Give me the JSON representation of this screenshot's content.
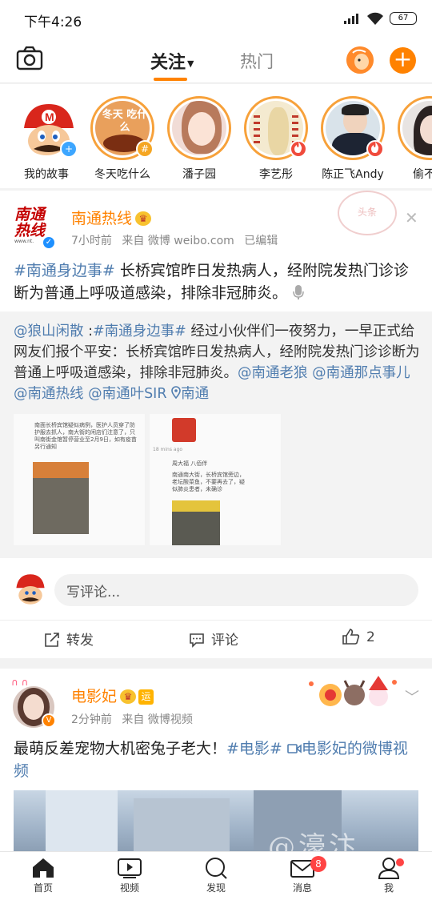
{
  "status_bar": {
    "time": "下午4:26",
    "battery": "67"
  },
  "top_nav": {
    "follow_tab": "关注",
    "hot_tab": "热门"
  },
  "stories": [
    {
      "name": "我的故事",
      "badge": "+"
    },
    {
      "name": "冬天吃什么",
      "cover_text": "冬天 吃什么",
      "badge": "#"
    },
    {
      "name": "潘子园"
    },
    {
      "name": "李艺彤",
      "badge": "fire"
    },
    {
      "name": "陈正飞Andy",
      "badge": "fire"
    },
    {
      "name": "偷不走"
    }
  ],
  "post1": {
    "logo_text": "南通热线",
    "logo_url": "www.nt.",
    "author": "南通热线",
    "time": "7小时前",
    "source": "来自 微博 weibo.com",
    "edited": "已编辑",
    "stamp": "头条",
    "topic_tag": "#南通身边事#",
    "text": " 长桥宾馆昨日发热病人，经附院发热门诊诊断为普通上呼吸道感染，排除非冠肺炎。",
    "retweet": {
      "user_mention": "@狼山闲散",
      "topic": "#南通身边事#",
      "text": "经过小伙伴们一夜努力，一早正式给网友们报个平安：长桥宾馆昨日发热病人，经附院发热门诊诊断为普通上呼吸道感染，排除非冠肺炎。",
      "mentions": [
        "@南通老狼",
        "@南通那点事儿",
        "@南通热线",
        "@南通叶SIR"
      ],
      "location": "南通",
      "image1_text": "南面长桥宾馆疑似病例，医护人员穿了防护服去抓人，南大街的闲店们注意了，只叫南街金馆暂停营业至2月9日，如有疫苗另行通知",
      "image2_user": "周大福 八佰伴",
      "image2_time": "18 mins ago",
      "image2_text": "南通南大街，长桥宾馆旁边，老坛酸菜鱼，不要再去了，疑似肺炎患者，未确诊"
    },
    "comment_placeholder": "写评论...",
    "actions": {
      "repost": "转发",
      "comment": "评论",
      "like_count": "2"
    }
  },
  "post2": {
    "author": "电影妃",
    "yun_badge": "运",
    "time": "2分钟前",
    "source": "来自 微博视频",
    "text": "最萌反差宠物大机密兔子老大！",
    "topic_tag": "#电影#",
    "video_link": "电影妃的微博视频",
    "watermark": "@濠汴"
  },
  "bottom_bar": {
    "items": [
      {
        "label": "首页",
        "icon": "home-icon"
      },
      {
        "label": "视频",
        "icon": "video-icon"
      },
      {
        "label": "发现",
        "icon": "search-icon"
      },
      {
        "label": "消息",
        "icon": "mail-icon"
      },
      {
        "label": "我",
        "icon": "person-icon"
      }
    ],
    "message_badge": "8"
  },
  "colors": {
    "accent": "#ff8200",
    "link": "#507daf"
  }
}
